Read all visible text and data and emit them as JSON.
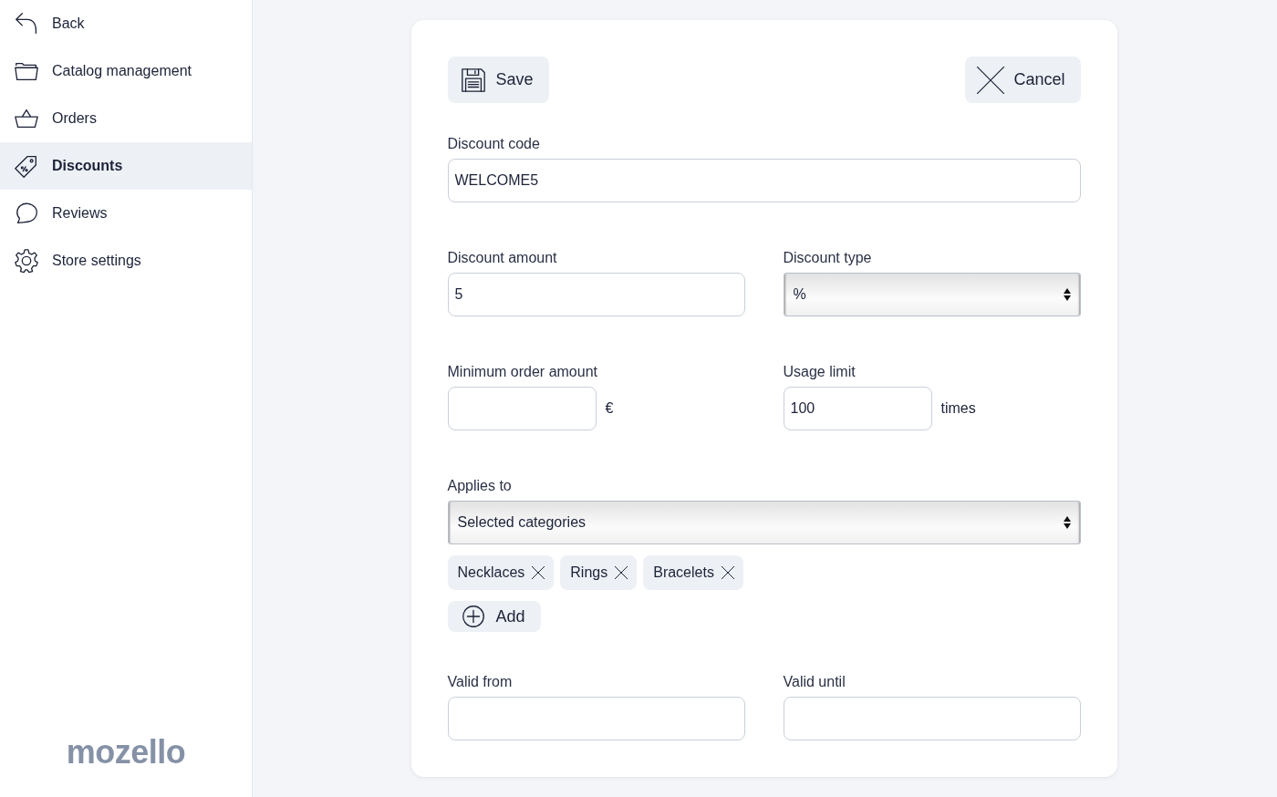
{
  "sidebar": {
    "items": [
      {
        "label": "Back",
        "selected": false
      },
      {
        "label": "Catalog management",
        "selected": false
      },
      {
        "label": "Orders",
        "selected": false
      },
      {
        "label": "Discounts",
        "selected": true
      },
      {
        "label": "Reviews",
        "selected": false
      },
      {
        "label": "Store settings",
        "selected": false
      }
    ],
    "logo": "mozello"
  },
  "form": {
    "save_button": "Save",
    "cancel_button": "Cancel",
    "discount_code": {
      "label": "Discount code",
      "value": "WELCOME5"
    },
    "discount_amount": {
      "label": "Discount amount",
      "value": "5"
    },
    "discount_type": {
      "label": "Discount type",
      "value": "%"
    },
    "minimum_order_amount": {
      "label": "Minimum order amount",
      "suffix": "€"
    },
    "usage_limit": {
      "label": "Usage limit",
      "value": "100",
      "suffix": "times"
    },
    "applies_to": {
      "label": "Applies to",
      "value": "Selected categories"
    },
    "tags": [
      "Necklaces",
      "Rings",
      "Bracelets"
    ],
    "add_button": "Add",
    "valid_from": {
      "label": "Valid from"
    },
    "valid_until": {
      "label": "Valid until"
    }
  }
}
